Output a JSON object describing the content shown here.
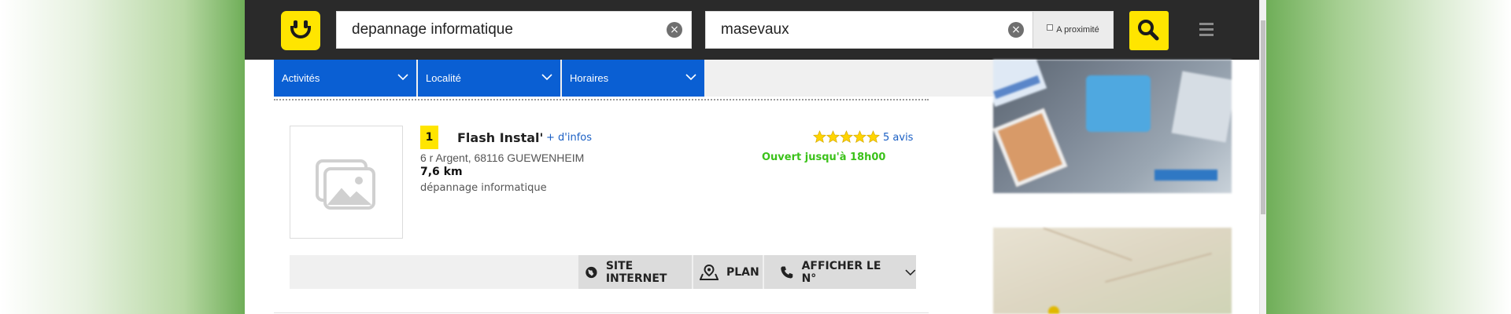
{
  "search": {
    "what": "depannage informatique",
    "where": "masevaux",
    "proximity_label": "A proximité"
  },
  "filters": [
    "Activités",
    "Localité",
    "Horaires"
  ],
  "result": {
    "rank": "1",
    "name": "Flash Instal'",
    "more_info": "+ d'infos",
    "address": "6 r Argent, 68116 GUEWENHEIM",
    "distance": "7,6 km",
    "activity": "dépannage informatique",
    "rating": 5,
    "reviews": "5 avis",
    "opening": "Ouvert jusqu'à 18h00"
  },
  "actions": {
    "site": "SITE INTERNET",
    "plan": "PLAN",
    "phone": "AFFICHER LE N°"
  },
  "colors": {
    "brand_yellow": "#ffe500",
    "filter_blue": "#0a5fd3",
    "link_blue": "#1a5fc4",
    "open_green": "#3bc21a",
    "topbar": "#2a2a2a"
  },
  "icons": [
    "logo-smiley-icon",
    "clear-icon",
    "search-icon",
    "menu-icon",
    "chevron-down-icon",
    "image-placeholder-icon",
    "star-icon",
    "globe-icon",
    "map-pin-icon",
    "phone-icon"
  ]
}
